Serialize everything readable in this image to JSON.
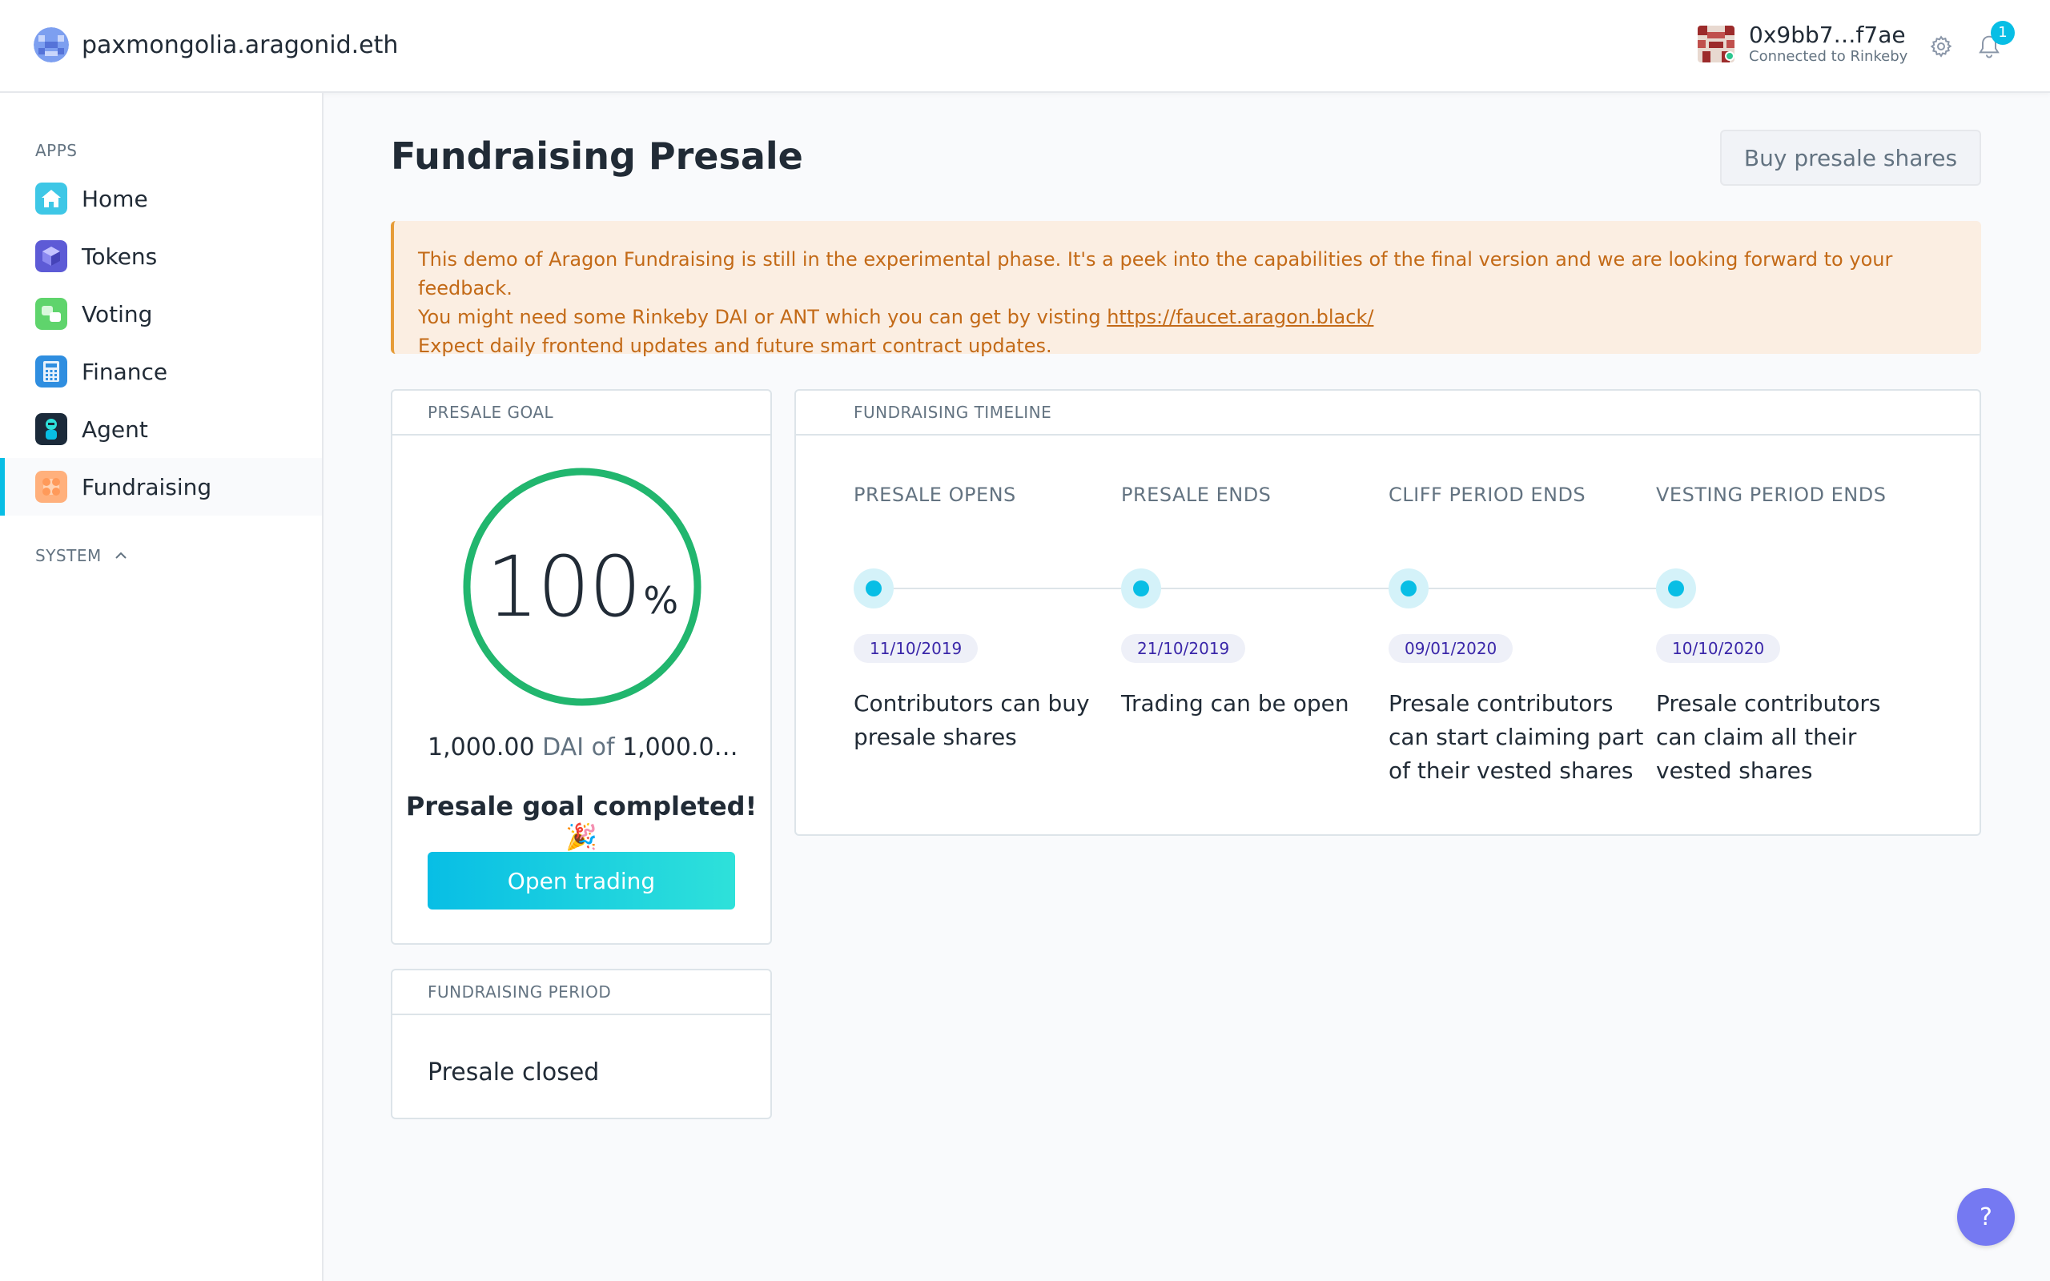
{
  "header": {
    "org_name": "paxmongolia.aragonid.eth",
    "account_address": "0x9bb7…f7ae",
    "account_network": "Connected to Rinkeby",
    "notification_count": "1",
    "icons": {
      "settings": "gear-icon",
      "notifications": "bell-icon"
    }
  },
  "sidebar": {
    "apps_heading": "APPS",
    "system_heading": "SYSTEM",
    "items": [
      {
        "label": "Home",
        "icon": "home-icon"
      },
      {
        "label": "Tokens",
        "icon": "tokens-icon"
      },
      {
        "label": "Voting",
        "icon": "voting-icon"
      },
      {
        "label": "Finance",
        "icon": "finance-icon"
      },
      {
        "label": "Agent",
        "icon": "agent-icon"
      },
      {
        "label": "Fundraising",
        "icon": "fundraising-icon",
        "active": true
      }
    ]
  },
  "main": {
    "title": "Fundraising Presale",
    "buy_button": "Buy presale shares",
    "notice": {
      "line1": "This demo of Aragon Fundraising is still in the experimental phase. It's a peek into the capabilities of the final version and we are looking forward to your feedback.",
      "line2_prefix": "You might need some Rinkeby DAI or ANT which you can get by visting ",
      "line2_link": "https://faucet.aragon.black/",
      "line3": "Expect daily frontend updates and future smart contract updates."
    },
    "presale_goal": {
      "heading": "PRESALE GOAL",
      "percent": "100",
      "percent_symbol": "%",
      "progress": 1.0,
      "amount_raised": "1,000.00",
      "amount_mid": " DAI of ",
      "amount_target": "1,000.0…",
      "status": "Presale goal completed! 🎉",
      "button": "Open trading"
    },
    "fundraising_period": {
      "heading": "FUNDRAISING PERIOD",
      "status": "Presale closed"
    },
    "timeline": {
      "heading": "FUNDRAISING TIMELINE",
      "steps": [
        {
          "label": "PRESALE OPENS",
          "date": "11/10/2019",
          "desc": "Contributors can buy presale shares"
        },
        {
          "label": "PRESALE ENDS",
          "date": "21/10/2019",
          "desc": "Trading can be open"
        },
        {
          "label": "CLIFF PERIOD ENDS",
          "date": "09/01/2020",
          "desc": "Presale contributors can start claiming part of their vested shares"
        },
        {
          "label": "VESTING PERIOD ENDS",
          "date": "10/10/2020",
          "desc": "Presale contributors can claim all their vested shares"
        }
      ]
    },
    "help_button": "?"
  },
  "colors": {
    "accent": "#08bee5",
    "progress": "#21b66e",
    "notice_bg": "#fbeee2",
    "notice_text": "#c36a17",
    "help_bg": "#7579f2"
  }
}
